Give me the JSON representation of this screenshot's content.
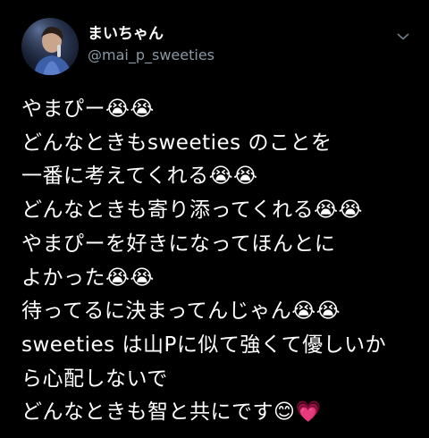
{
  "tweet": {
    "author": {
      "display_name": "まいちゃん",
      "handle": "@mai_p_sweeties",
      "avatar_icon": "profile-photo-avatar",
      "menu_icon": "chevron-down-icon"
    },
    "lines": [
      "やまぴー😭😭",
      "どんなときもsweeties のことを",
      "一番に考えてくれる😭😭",
      "どんなときも寄り添ってくれる😭😭",
      "やまぴーを好きになってほんとに",
      "よかった😭😭",
      "待ってるに決まってんじゃん😭😭",
      "sweeties は山Pに似て強くて優しいか",
      "ら心配しないで",
      "どんなときも智と共にです😊💗"
    ]
  },
  "colors": {
    "background": "#000000",
    "text_primary": "#ffffff",
    "text_secondary": "#8b98a5"
  }
}
